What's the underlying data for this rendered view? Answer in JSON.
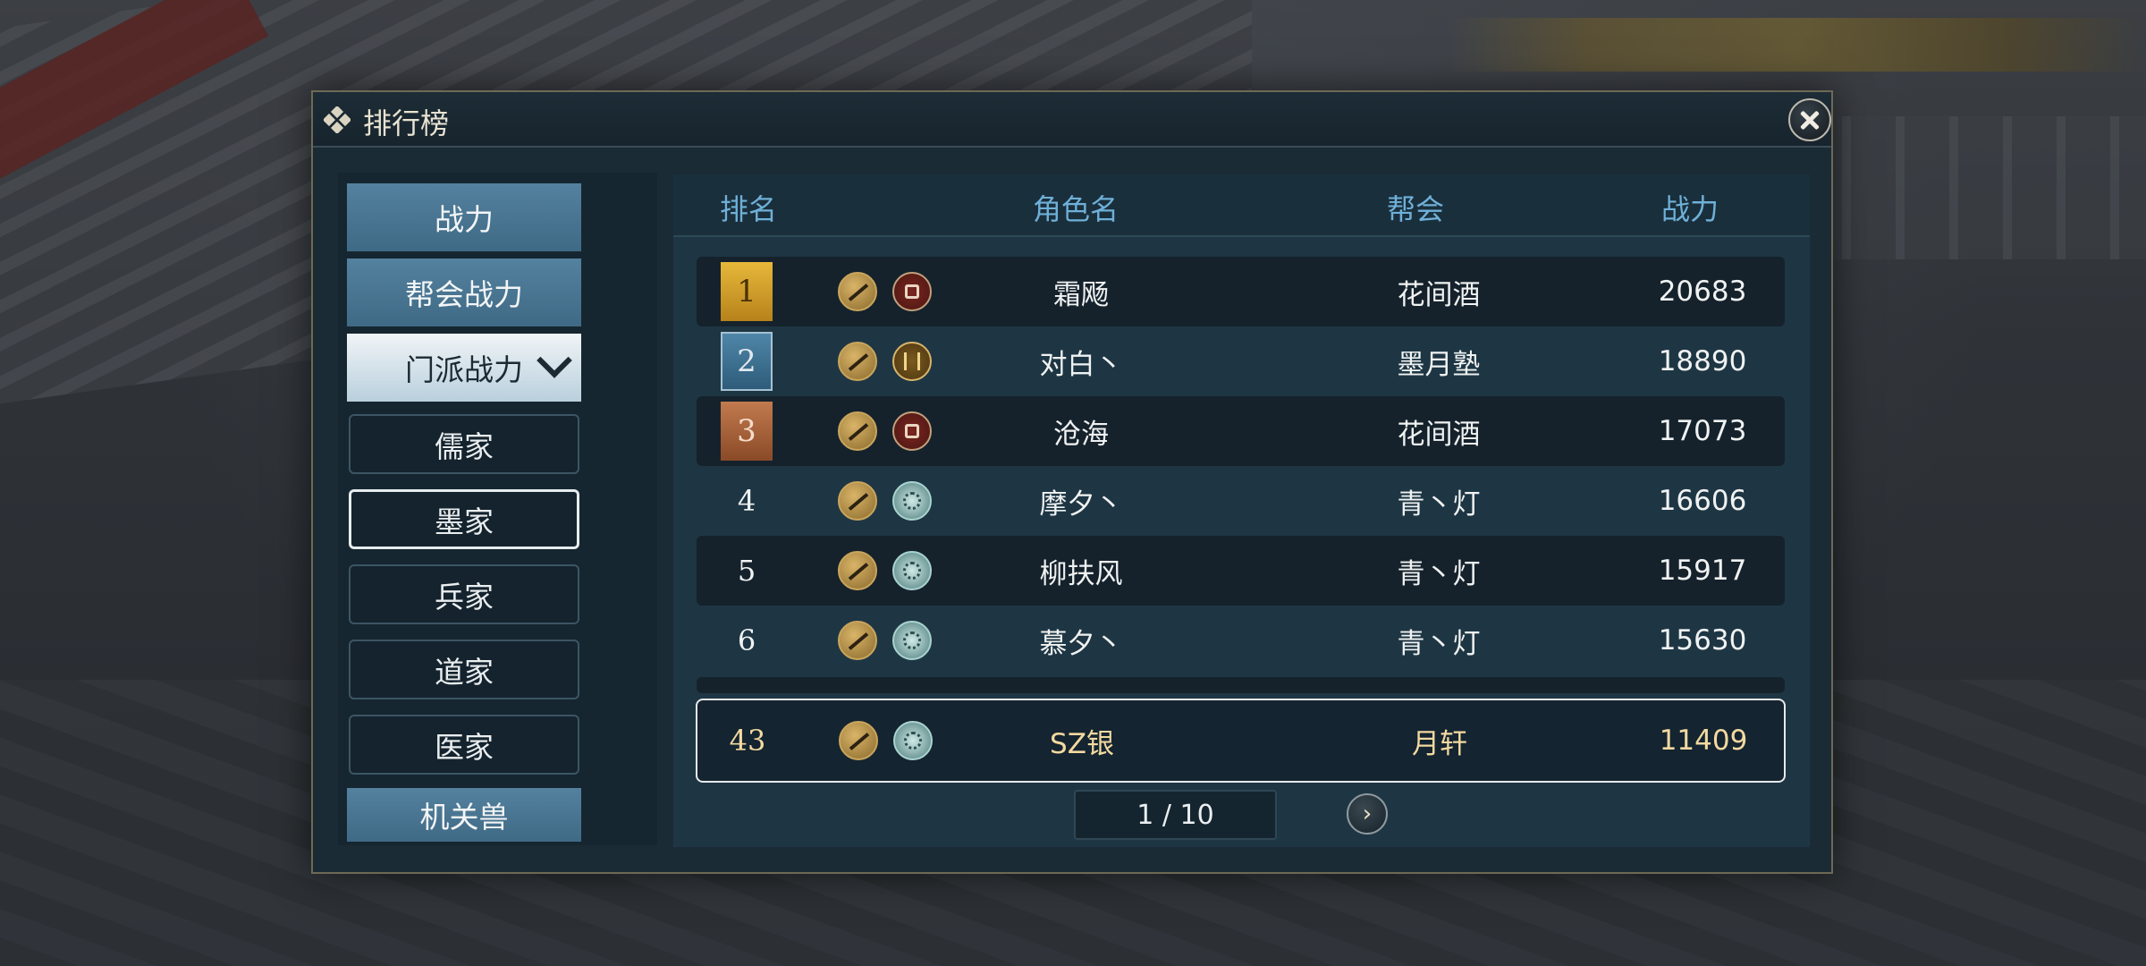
{
  "dialog": {
    "title": "排行榜"
  },
  "sidebar": {
    "items": [
      {
        "label": "战力"
      },
      {
        "label": "帮会战力"
      },
      {
        "label": "门派战力"
      },
      {
        "label": "儒家"
      },
      {
        "label": "墨家"
      },
      {
        "label": "兵家"
      },
      {
        "label": "道家"
      },
      {
        "label": "医家"
      },
      {
        "label": "机关兽"
      }
    ]
  },
  "table": {
    "headers": {
      "rank": "排名",
      "name": "角色名",
      "guild": "帮会",
      "power": "战力"
    },
    "rows": [
      {
        "rank": "1",
        "name": "霜飏",
        "guild": "花间酒",
        "power": "20683",
        "badge": "gold",
        "faction_icon": "red-seal-icon"
      },
      {
        "rank": "2",
        "name": "对白丶",
        "guild": "墨月塾",
        "power": "18890",
        "badge": "silver",
        "faction_icon": "gold-seal-icon"
      },
      {
        "rank": "3",
        "name": "沧海",
        "guild": "花间酒",
        "power": "17073",
        "badge": "bronze",
        "faction_icon": "red-seal-icon"
      },
      {
        "rank": "4",
        "name": "摩夕丶",
        "guild": "青丶灯",
        "power": "16606",
        "faction_icon": "teal-seal-icon"
      },
      {
        "rank": "5",
        "name": "柳扶风",
        "guild": "青丶灯",
        "power": "15917",
        "faction_icon": "teal-seal-icon"
      },
      {
        "rank": "6",
        "name": "慕夕丶",
        "guild": "青丶灯",
        "power": "15630",
        "faction_icon": "teal-seal-icon"
      }
    ],
    "my_row": {
      "rank": "43",
      "name": "SZ银",
      "guild": "月轩",
      "power": "11409",
      "faction_icon": "teal-seal-icon"
    }
  },
  "pagination": {
    "text": "1 / 10",
    "next_glyph": "›"
  },
  "colors": {
    "header_text": "#6fb0d8",
    "my_row_text": "#f3d9a0",
    "sidebar_main": "#4a7896"
  }
}
